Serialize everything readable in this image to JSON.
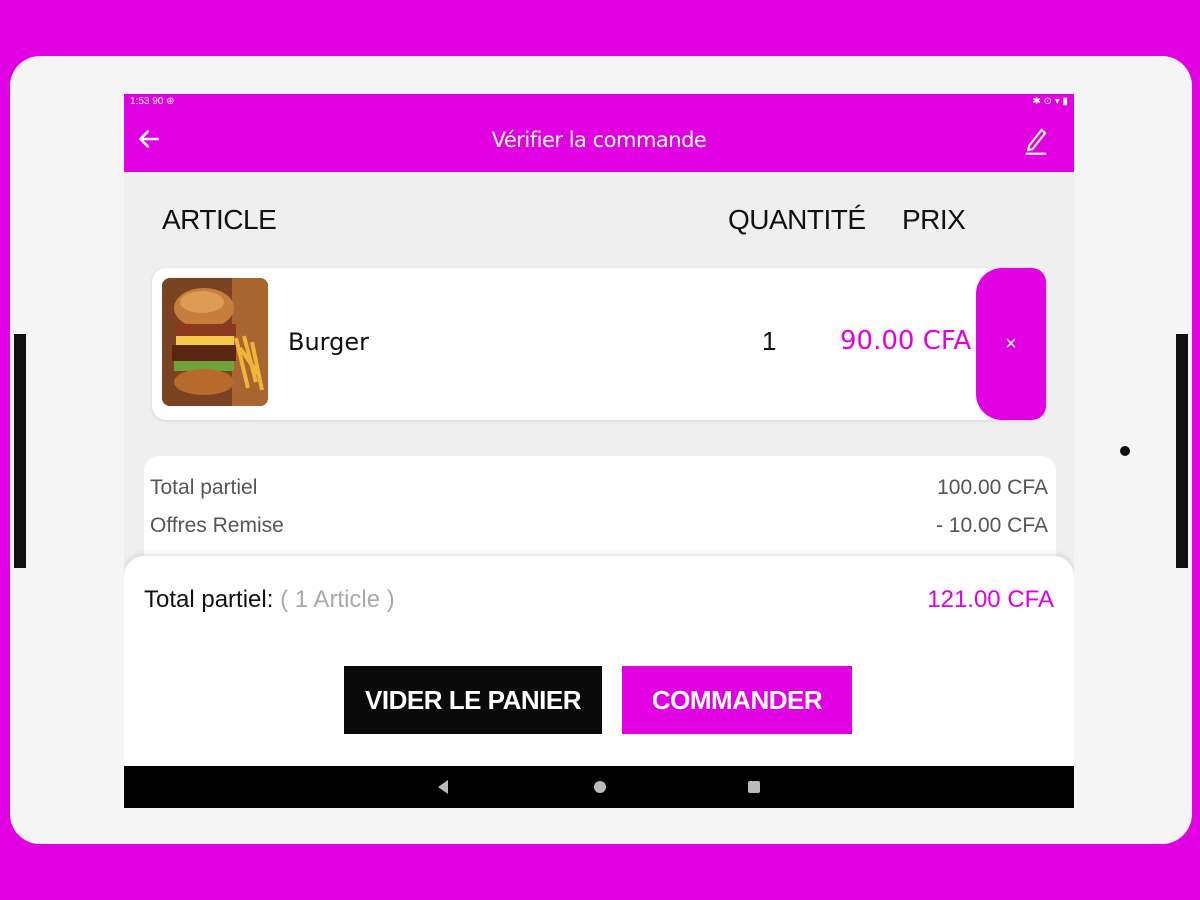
{
  "statusbar": {
    "time": "1:53",
    "left_icons": "90 ⊛",
    "right_icons": "✱ ⊙ ▾ ▮"
  },
  "appbar": {
    "title": "Vérifier la commande",
    "back_icon": "arrow-left-icon",
    "edit_icon": "pencil-icon"
  },
  "columns": {
    "article": "ARTICLE",
    "quantity": "QUANTITÉ",
    "price": "PRIX"
  },
  "cart_items": [
    {
      "name": "Burger",
      "quantity": "1",
      "price": "90.00 CFA",
      "remove_label": "×"
    }
  ],
  "summary": {
    "subtotal_label": "Total partiel",
    "subtotal_value": "100.00 CFA",
    "discount_label": "Offres Remise",
    "discount_value": "- 10.00 CFA"
  },
  "footer": {
    "total_label": "Total partiel:",
    "total_count": "( 1 Article )",
    "total_value": "121.00 CFA",
    "clear_button": "VIDER LE PANIER",
    "order_button": "COMMANDER"
  },
  "colors": {
    "accent": "#e100e1",
    "dark": "#0a0a0a"
  }
}
